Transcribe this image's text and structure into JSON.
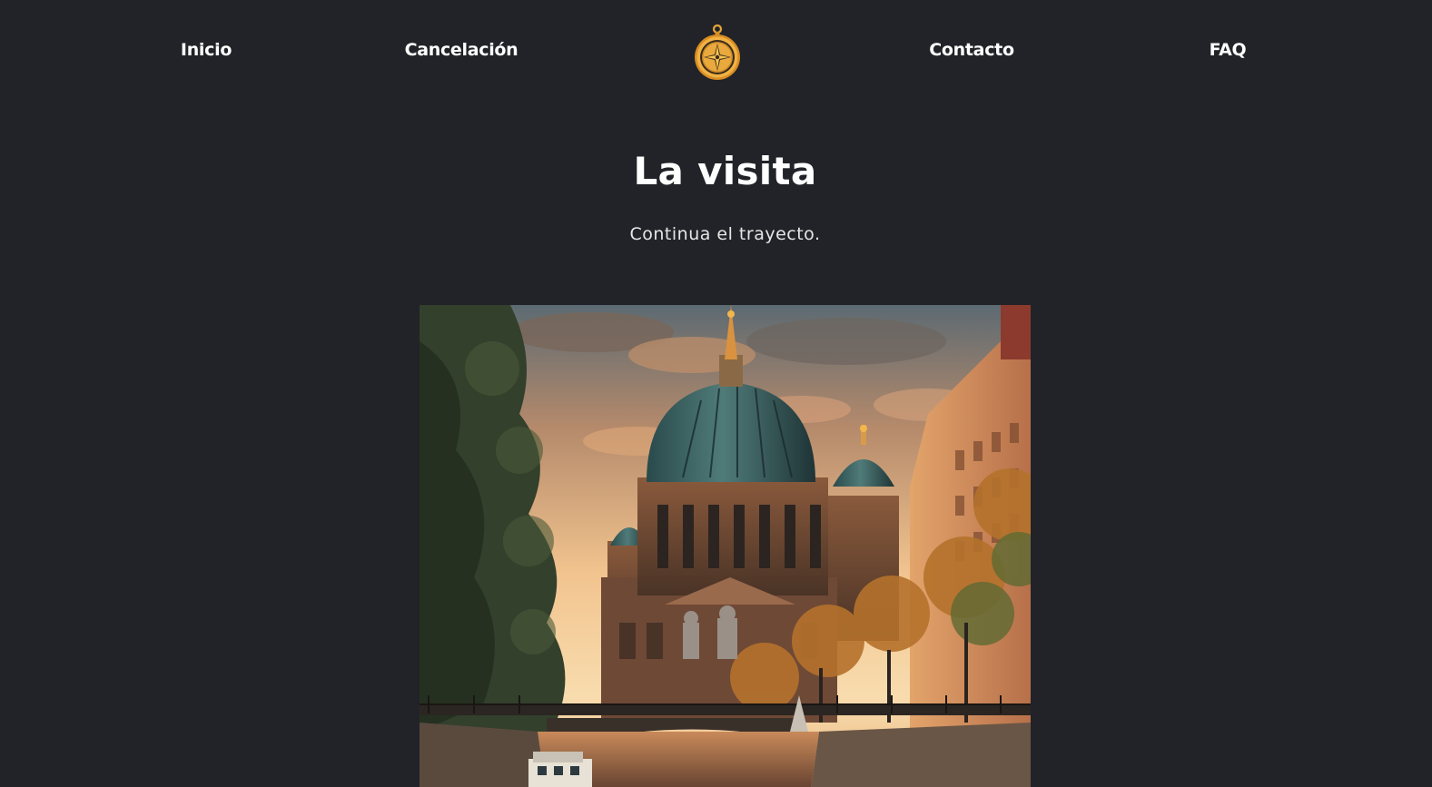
{
  "nav": {
    "items": [
      {
        "label": "Inicio"
      },
      {
        "label": "Cancelación"
      },
      {
        "label": "Contacto"
      },
      {
        "label": "FAQ"
      }
    ],
    "logo_icon": "compass-icon"
  },
  "main": {
    "title": "La visita",
    "subtitle": "Continua el trayecto.",
    "hero_image": "cathedral-river-sunset-image"
  },
  "colors": {
    "background": "#212328",
    "text": "#ffffff",
    "accent": "#e8a53a"
  }
}
